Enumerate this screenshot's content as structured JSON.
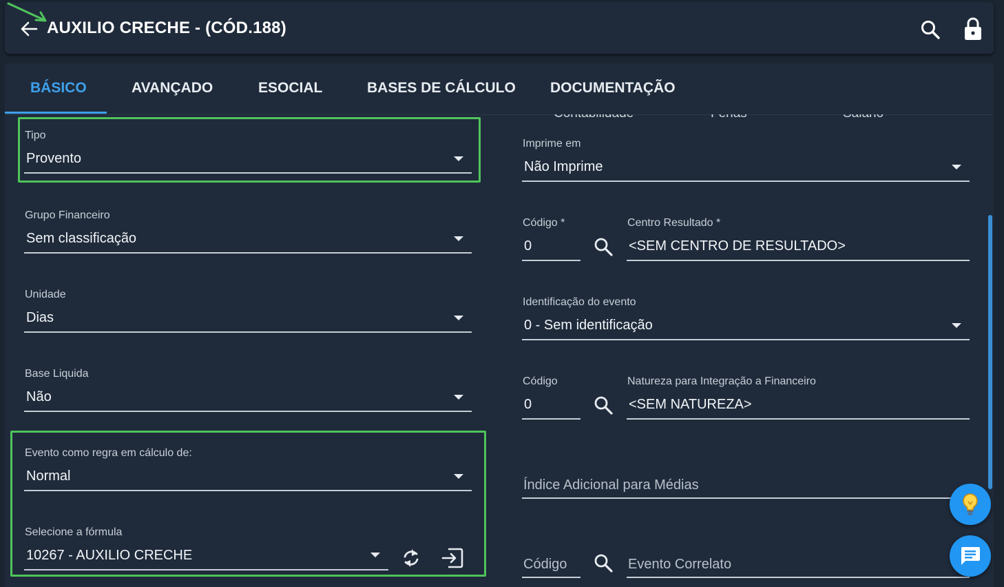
{
  "header": {
    "title": "AUXILIO CRECHE - (CÓD.188)",
    "back_icon": "arrow-left-icon",
    "search_icon": "search-icon",
    "lock_icon": "lock-icon"
  },
  "tabs": [
    {
      "label": "BÁSICO",
      "active": true
    },
    {
      "label": "AVANÇADO",
      "active": false
    },
    {
      "label": "ESOCIAL",
      "active": false
    },
    {
      "label": "BASES DE CÁLCULO",
      "active": false
    },
    {
      "label": "DOCUMENTAÇÃO",
      "active": false
    }
  ],
  "clipped_options": [
    "Contabilidade",
    "Férias",
    "Salário"
  ],
  "left": {
    "tipo": {
      "label": "Tipo",
      "value": "Provento"
    },
    "grupo_financeiro": {
      "label": "Grupo Financeiro",
      "value": "Sem classificação"
    },
    "unidade": {
      "label": "Unidade",
      "value": "Dias"
    },
    "base_liquida": {
      "label": "Base Liquida",
      "value": "Não"
    },
    "evento_regra": {
      "label": "Evento como regra em cálculo de:",
      "value": "Normal"
    },
    "formula": {
      "label": "Selecione a fórmula",
      "value": "10267 - AUXILIO CRECHE"
    }
  },
  "right": {
    "imprime_em": {
      "label": "Imprime em",
      "value": "Não Imprime"
    },
    "codigo_centro": {
      "label": "Código *",
      "value": "0"
    },
    "centro_resultado": {
      "label": "Centro Resultado *",
      "value": "<SEM CENTRO DE RESULTADO>"
    },
    "identificacao": {
      "label": "Identificação do evento",
      "value": "0 - Sem identificação"
    },
    "codigo_natureza": {
      "label": "Código",
      "value": "0"
    },
    "natureza": {
      "label": "Natureza para Integração a Financeiro",
      "value": "<SEM NATUREZA>"
    },
    "indice_adicional": {
      "placeholder": "Índice Adicional para Médias"
    },
    "codigo_correlato": {
      "placeholder": "Código"
    },
    "evento_correlato": {
      "placeholder": "Evento Correlato"
    }
  },
  "colors": {
    "background": "#1b2431",
    "surface": "#1f2b3b",
    "accent": "#3ea1ec",
    "highlight": "#4fc45b"
  },
  "fabs": [
    "lightbulb-icon",
    "chat-icon"
  ]
}
